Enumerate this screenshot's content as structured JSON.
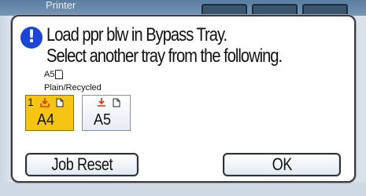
{
  "background": {
    "title": "Printer"
  },
  "dialog": {
    "icon": "exclamation-icon",
    "message_line1": "Load ppr blw in Bypass Tray.",
    "message_line2": "Select another tray from the following.",
    "paper_size": "A5",
    "paper_type": "Plain/Recycled",
    "trays": [
      {
        "number": "1",
        "size": "A4",
        "selected": true,
        "color": "#f6c514"
      },
      {
        "number": "",
        "size": "A5",
        "selected": false,
        "color": "#e7eaf3"
      }
    ],
    "buttons": {
      "job_reset": "Job Reset",
      "ok": "OK"
    }
  },
  "colors": {
    "alert_icon": "#1b45d6",
    "tray_arrow": "#e03a1a",
    "selected_tray": "#f6c514"
  }
}
